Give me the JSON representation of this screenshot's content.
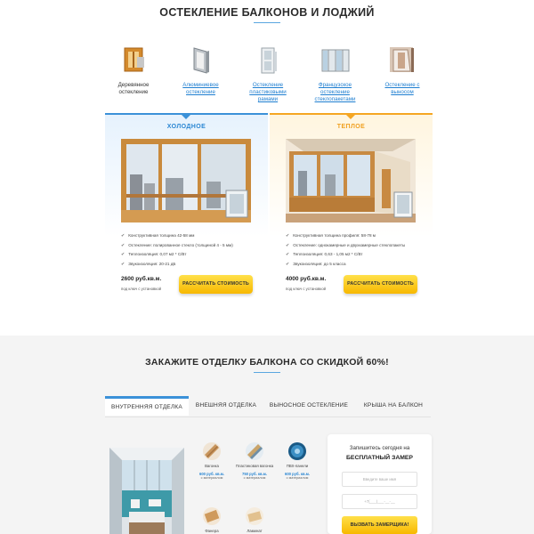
{
  "header": {
    "title": "ОСТЕКЛЕНИЕ БАЛКОНОВ И ЛОДЖИЙ"
  },
  "glazing_types": [
    {
      "label": "Деревянное остекление",
      "icon": "wooden-window-icon"
    },
    {
      "label": "Алюминиевое остекление",
      "icon": "aluminum-window-icon"
    },
    {
      "label": "Остекление пластиковыми рамами",
      "icon": "plastic-window-icon"
    },
    {
      "label": "Французское остекление стеклопакетами",
      "icon": "french-window-icon"
    },
    {
      "label": "Остекление с выносом",
      "icon": "extended-window-icon"
    }
  ],
  "cards": {
    "cold": {
      "title": "ХОЛОДНОЕ",
      "features": [
        "Конструктивная толщина 42-58 мм",
        "Остекление: полированное стекло (толщиной 4 - 5 мм)",
        "Теплоизоляция: 0,07 м2 * С/Вт",
        "Звукоизоляция: 20-21 дБ"
      ],
      "price": "2600 руб.кв.м.",
      "price_note": "под ключ с установкой",
      "button": "РАССЧИТАТЬ СТОИМОСТЬ",
      "accent": "#3b91d8"
    },
    "warm": {
      "title": "ТЕПЛОЕ",
      "features": [
        "Конструктивная толщина профиля: 58-78 м",
        "Остекление: однокамерные и двухкамерные стеклопакеты",
        "Теплоизоляция: 0,63 - 1,05 м2 * С/Вт",
        "Звукоизоляция: до 5 класса"
      ],
      "price": "4000 руб.кв.м.",
      "price_note": "под ключ с установкой",
      "button": "РАССЧИТАТЬ СТОИМОСТЬ",
      "accent": "#f5a623"
    }
  },
  "promo": {
    "title": "ЗАКАЖИТЕ ОТДЕЛКУ БАЛКОНА СО СКИДКОЙ 60%!"
  },
  "tabs": [
    {
      "label": "ВНУТРЕННЯЯ ОТДЕЛКА",
      "active": true
    },
    {
      "label": "ВНЕШНЯЯ ОТДЕЛКА",
      "active": false
    },
    {
      "label": "ВЫНОСНОЕ ОСТЕКЛЕНИЕ",
      "active": false
    },
    {
      "label": "КРЫША НА БАЛКОН",
      "active": false
    }
  ],
  "materials": [
    {
      "name": "Вагонка",
      "price": "600 руб. кв.м.",
      "sub": "с материалом"
    },
    {
      "name": "Пластиковая вагонка",
      "price": "750 руб. кв.м.",
      "sub": "с материалом"
    },
    {
      "name": "ПВХ-панели",
      "price": "600 руб. кв.м.",
      "sub": "с материалом"
    },
    {
      "name": "Фанера",
      "price": "",
      "sub": ""
    },
    {
      "name": "Ламинат",
      "price": "",
      "sub": ""
    }
  ],
  "form": {
    "line1": "Запишитесь сегодня на",
    "line2": "БЕСПЛАТНЫЙ ЗАМЕР",
    "name_placeholder": "Введите ваше имя",
    "phone_placeholder": "+7(___)___-__-__",
    "button": "ВЫЗВАТЬ ЗАМЕРЩИКА!"
  },
  "colors": {
    "blue": "#3b91d8",
    "orange": "#f5a623",
    "yellow": "#f7b800"
  }
}
